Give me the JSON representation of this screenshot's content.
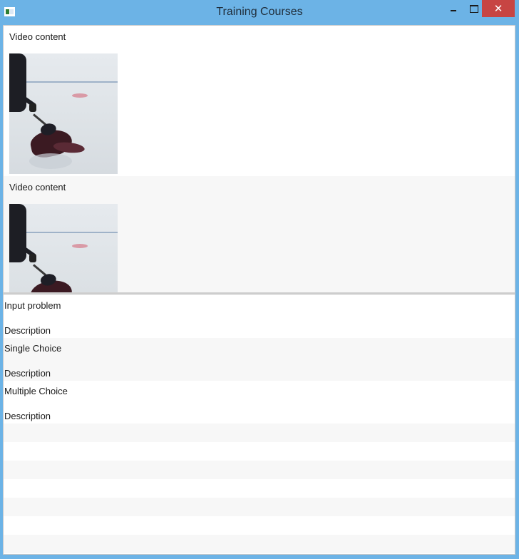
{
  "window": {
    "title": "Training Courses",
    "close_glyph": "✕",
    "icons": [
      "app-icon",
      "minimize-icon",
      "maximize-icon",
      "close-icon"
    ]
  },
  "videos": [
    {
      "label": "Video content",
      "thumbnail": "hockey-training-clip"
    },
    {
      "label": "Video content",
      "thumbnail": "hockey-training-clip"
    }
  ],
  "questions": [
    {
      "type": "Input problem",
      "description": "Description"
    },
    {
      "type": "Single Choice",
      "description": "Description"
    },
    {
      "type": "Multiple Choice",
      "description": "Description"
    }
  ],
  "colors": {
    "titlebar": "#6cb3e6",
    "close_button": "#c74543",
    "alt_row": "#f7f7f7"
  }
}
